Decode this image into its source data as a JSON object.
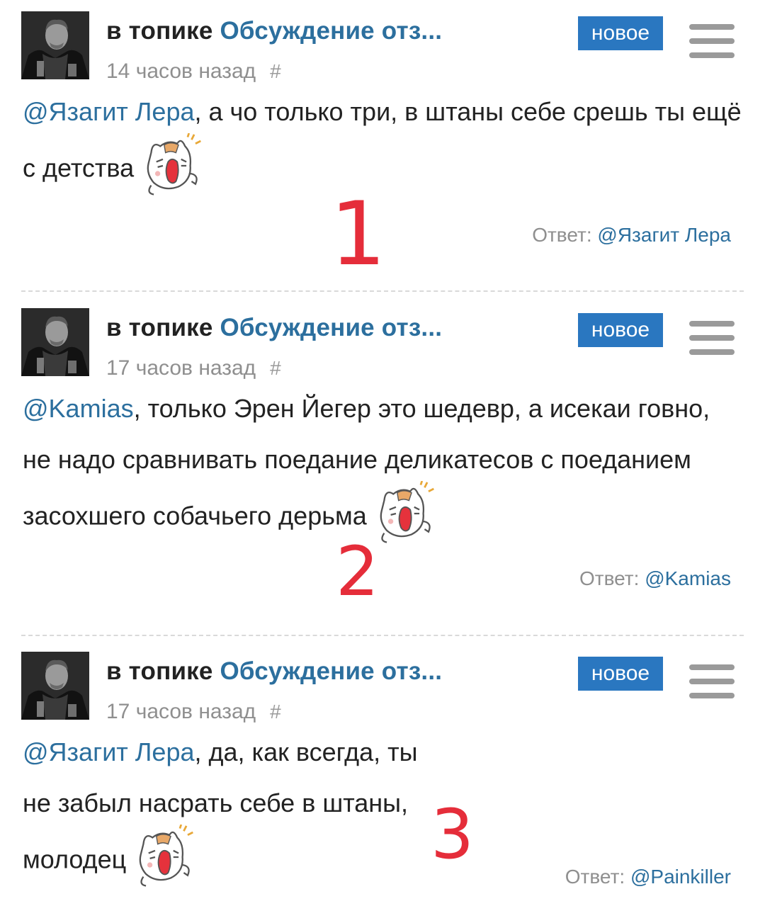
{
  "comments": [
    {
      "topic_prefix": "в топике",
      "topic_title": "Обсуждение отз...",
      "time": "14 часов назад",
      "hash": "#",
      "badge": "новое",
      "mention": "@Язагит Лера",
      "text": ", а чо только три, в штаны себе срешь ты ещё с детства",
      "reply_label": "Ответ:",
      "reply_to": "@Язагит Лера",
      "marker": "1",
      "sticker_icon": "screaming-cat-sticker",
      "avatar_icon": "portrait-photo"
    },
    {
      "topic_prefix": "в топике",
      "topic_title": "Обсуждение отз...",
      "time": "17 часов назад",
      "hash": "#",
      "badge": "новое",
      "mention": "@Kamias",
      "text": ", только Эрен Йегер это шедевр, а исекаи говно, не надо сравнивать поедание деликатесов с поеданием засохшего собачьего дерьма",
      "reply_label": "Ответ:",
      "reply_to": "@Kamias",
      "marker": "2",
      "sticker_icon": "screaming-cat-sticker",
      "avatar_icon": "portrait-photo"
    },
    {
      "topic_prefix": "в топике",
      "topic_title": "Обсуждение отз...",
      "time": "17 часов назад",
      "hash": "#",
      "badge": "новое",
      "mention": "@Язагит Лера",
      "text": ", да, как всегда, ты не забыл насрать себе в штаны, молодец",
      "reply_label": "Ответ:",
      "reply_to": "@Painkiller",
      "marker": "3",
      "sticker_icon": "screaming-cat-sticker",
      "avatar_icon": "portrait-photo"
    }
  ],
  "colors": {
    "link": "#2c6f9e",
    "badge_bg": "#2a77c0",
    "marker": "#e52d3a",
    "meta": "#8f8f8f"
  }
}
